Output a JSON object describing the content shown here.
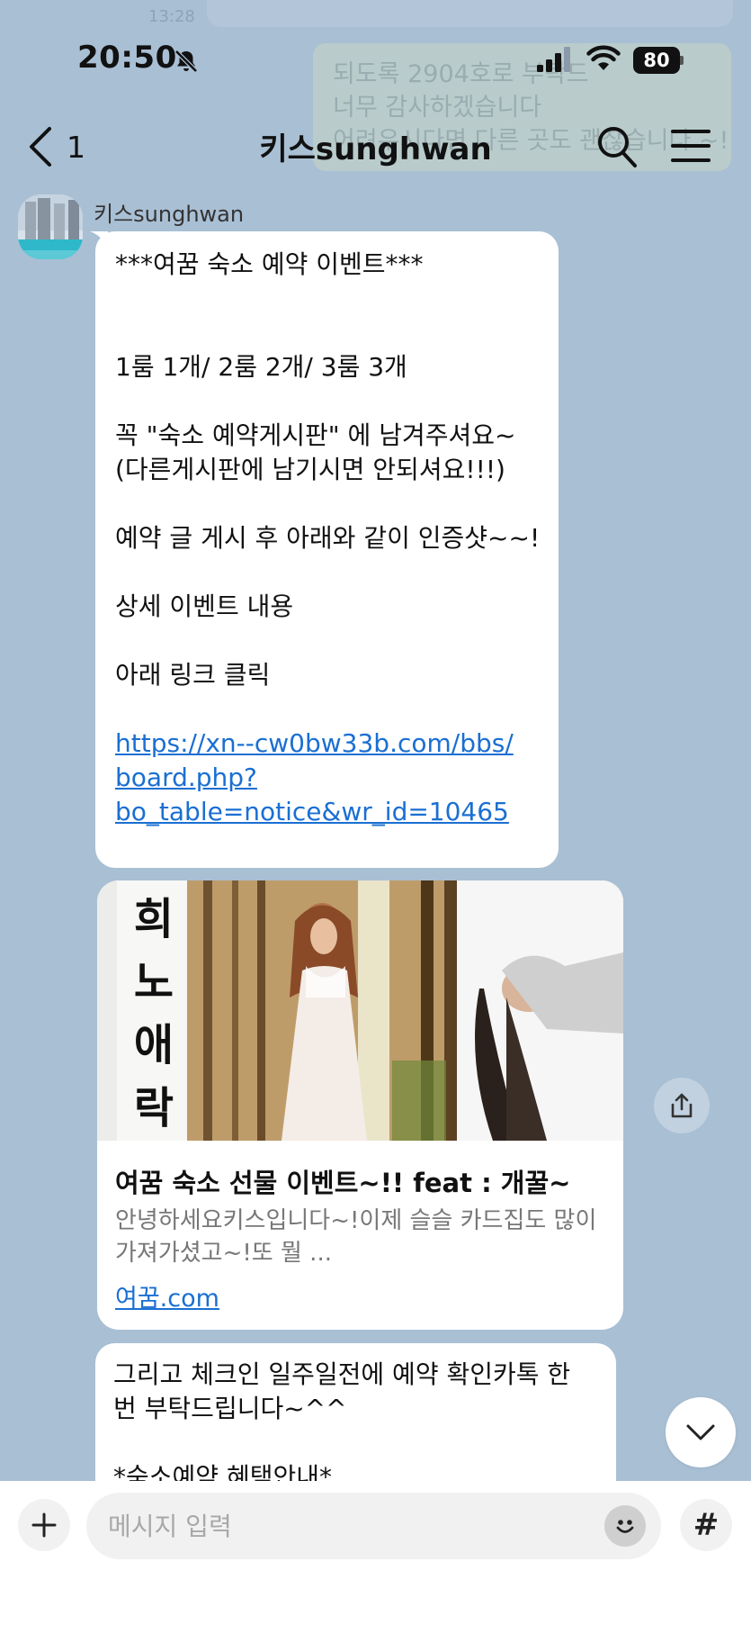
{
  "status_bar": {
    "time": "20:50",
    "battery": "80"
  },
  "background_ghost": {
    "time": "13:28",
    "lines": [
      "되도록 2904호로 부탁드",
      "너무 감사하겠습니다",
      "어려우시다면 다른 곳도 괜찮습니다 ~!"
    ]
  },
  "header": {
    "back_count": "1",
    "title": "키스sunghwan"
  },
  "sender": {
    "name": "키스sunghwan"
  },
  "message_1": {
    "lines": [
      "***여꿈 숙소 예약 이벤트***",
      "",
      "",
      "1룸 1개/ 2룸 2개/ 3룸 3개",
      "",
      "꼭  \"숙소 예약게시판\" 에 남겨주셔요~",
      "(다른게시판에 남기시면 안되셔요!!!)",
      "",
      "예약 글 게시 후 아래와 같이 인증샷~~!",
      "",
      "상세 이벤트 내용",
      "",
      "아래 링크 클릭",
      ""
    ],
    "link_lines": [
      "https://xn--cw0bw33b.com/bbs/",
      "board.php?",
      "bo_table=notice&wr_id=10465"
    ]
  },
  "link_card": {
    "image_text": [
      "희",
      "노",
      "애",
      "락"
    ],
    "title": "여꿈 숙소 선물 이벤트~!! feat : 개꿀~",
    "description": "안녕하세요키스입니다~!이제 슬슬 카드집도 많이 가져가셨고~!또 뭘 ...",
    "domain": "여꿈.com"
  },
  "message_3": {
    "lines": [
      "그리고 체크인 일주일전에 예약 확인카톡 한",
      "번 부탁드립니다~^^",
      "",
      "*숙소예약 혜택안내*"
    ]
  },
  "input_bar": {
    "placeholder": "메시지 입력",
    "hash_label": "#"
  },
  "colors": {
    "background": "#a9bfd4",
    "link": "#1a6fd2",
    "bubble": "#ffffff"
  }
}
